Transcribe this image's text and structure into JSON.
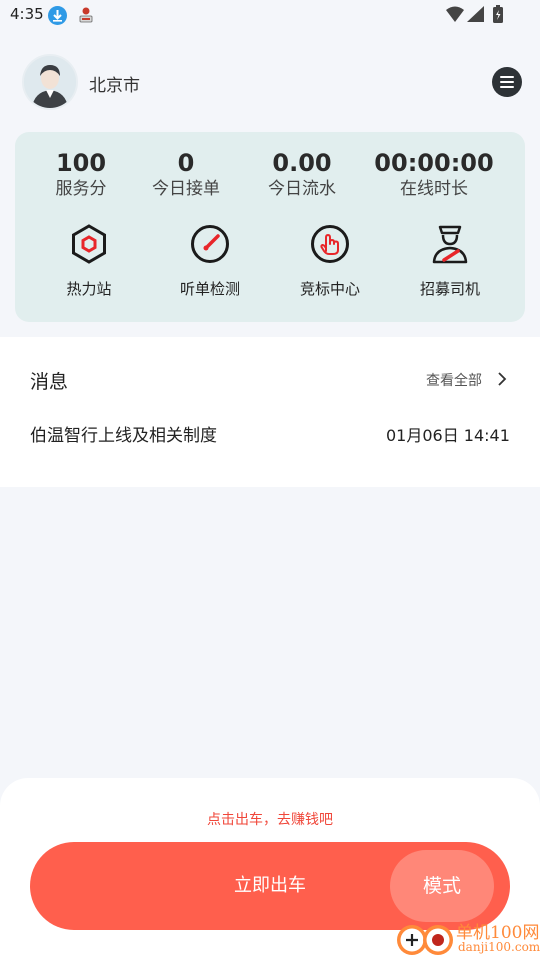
{
  "status_bar": {
    "time": "4:35"
  },
  "header": {
    "city": "北京市",
    "icons": {
      "avatar": "avatar",
      "menu": "menu-icon"
    }
  },
  "stats": [
    {
      "value": "100",
      "label": "服务分"
    },
    {
      "value": "0",
      "label": "今日接单"
    },
    {
      "value": "0.00",
      "label": "今日流水"
    },
    {
      "value": "00:00:00",
      "label": "在线时长"
    }
  ],
  "tools": [
    {
      "label": "热力站",
      "icon": "hexagon-icon"
    },
    {
      "label": "听单检测",
      "icon": "gauge-icon"
    },
    {
      "label": "竞标中心",
      "icon": "tap-hand-icon"
    },
    {
      "label": "招募司机",
      "icon": "driver-icon"
    }
  ],
  "messages": {
    "title": "消息",
    "view_all": "查看全部",
    "items": [
      {
        "text": "伯温智行上线及相关制度",
        "date": "01月06日 14:41"
      }
    ]
  },
  "bottom": {
    "hint": "点击出车，去赚钱吧",
    "go_label": "立即出车",
    "mode_label": "模式"
  },
  "watermark": {
    "cn": "单机100网",
    "url": "danji100.com"
  },
  "colors": {
    "accent": "#ff5f4d",
    "mode": "#ff8778",
    "hint": "#f0473a",
    "card": "#e1eeee",
    "icon_red": "#e8262a"
  }
}
